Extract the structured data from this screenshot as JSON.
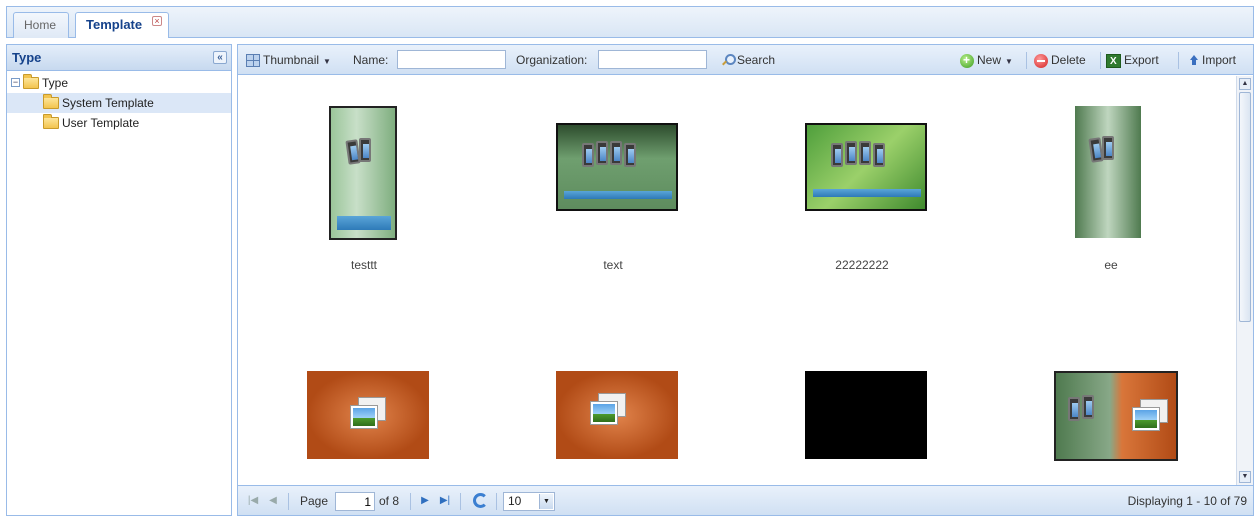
{
  "tabs": [
    {
      "label": "Home"
    },
    {
      "label": "Template",
      "close": "×"
    }
  ],
  "left_panel": {
    "title": "Type",
    "collapse": "«",
    "tree": {
      "root": {
        "label": "Type",
        "expander": "−"
      },
      "children": [
        {
          "label": "System Template",
          "selected": true
        },
        {
          "label": "User Template",
          "selected": false
        }
      ]
    }
  },
  "toolbar": {
    "view_mode": "Thumbnail",
    "name_label": "Name:",
    "name_value": "",
    "org_label": "Organization:",
    "org_value": "",
    "search_label": "Search",
    "new_label": "New",
    "delete_label": "Delete",
    "export_label": "Export",
    "import_label": "Import"
  },
  "templates": [
    {
      "name": "testtt",
      "orientation": "portrait",
      "background": "green",
      "icon": "film-icon"
    },
    {
      "name": "text",
      "orientation": "landscape",
      "background": "green",
      "icon": "film-icon"
    },
    {
      "name": "22222222",
      "orientation": "landscape",
      "background": "green",
      "icon": "film-icon"
    },
    {
      "name": "ee",
      "orientation": "portrait",
      "background": "green",
      "icon": "film-icon"
    },
    {
      "name": "",
      "orientation": "landscape",
      "background": "orange",
      "icon": "image-icon"
    },
    {
      "name": "",
      "orientation": "landscape",
      "background": "orange",
      "icon": "image-icon"
    },
    {
      "name": "",
      "orientation": "landscape",
      "background": "black",
      "icon": ""
    },
    {
      "name": "",
      "orientation": "landscape",
      "background": "split",
      "icon": "film-icon"
    }
  ],
  "pager": {
    "page_label": "Page",
    "page_value": "1",
    "of_label": "of 8",
    "page_size": "10",
    "display_text": "Displaying 1 - 10 of 79"
  },
  "colors": {
    "panel_border": "#99bbe8",
    "header_text": "#15428b",
    "selected_row": "#dbe7f7"
  }
}
